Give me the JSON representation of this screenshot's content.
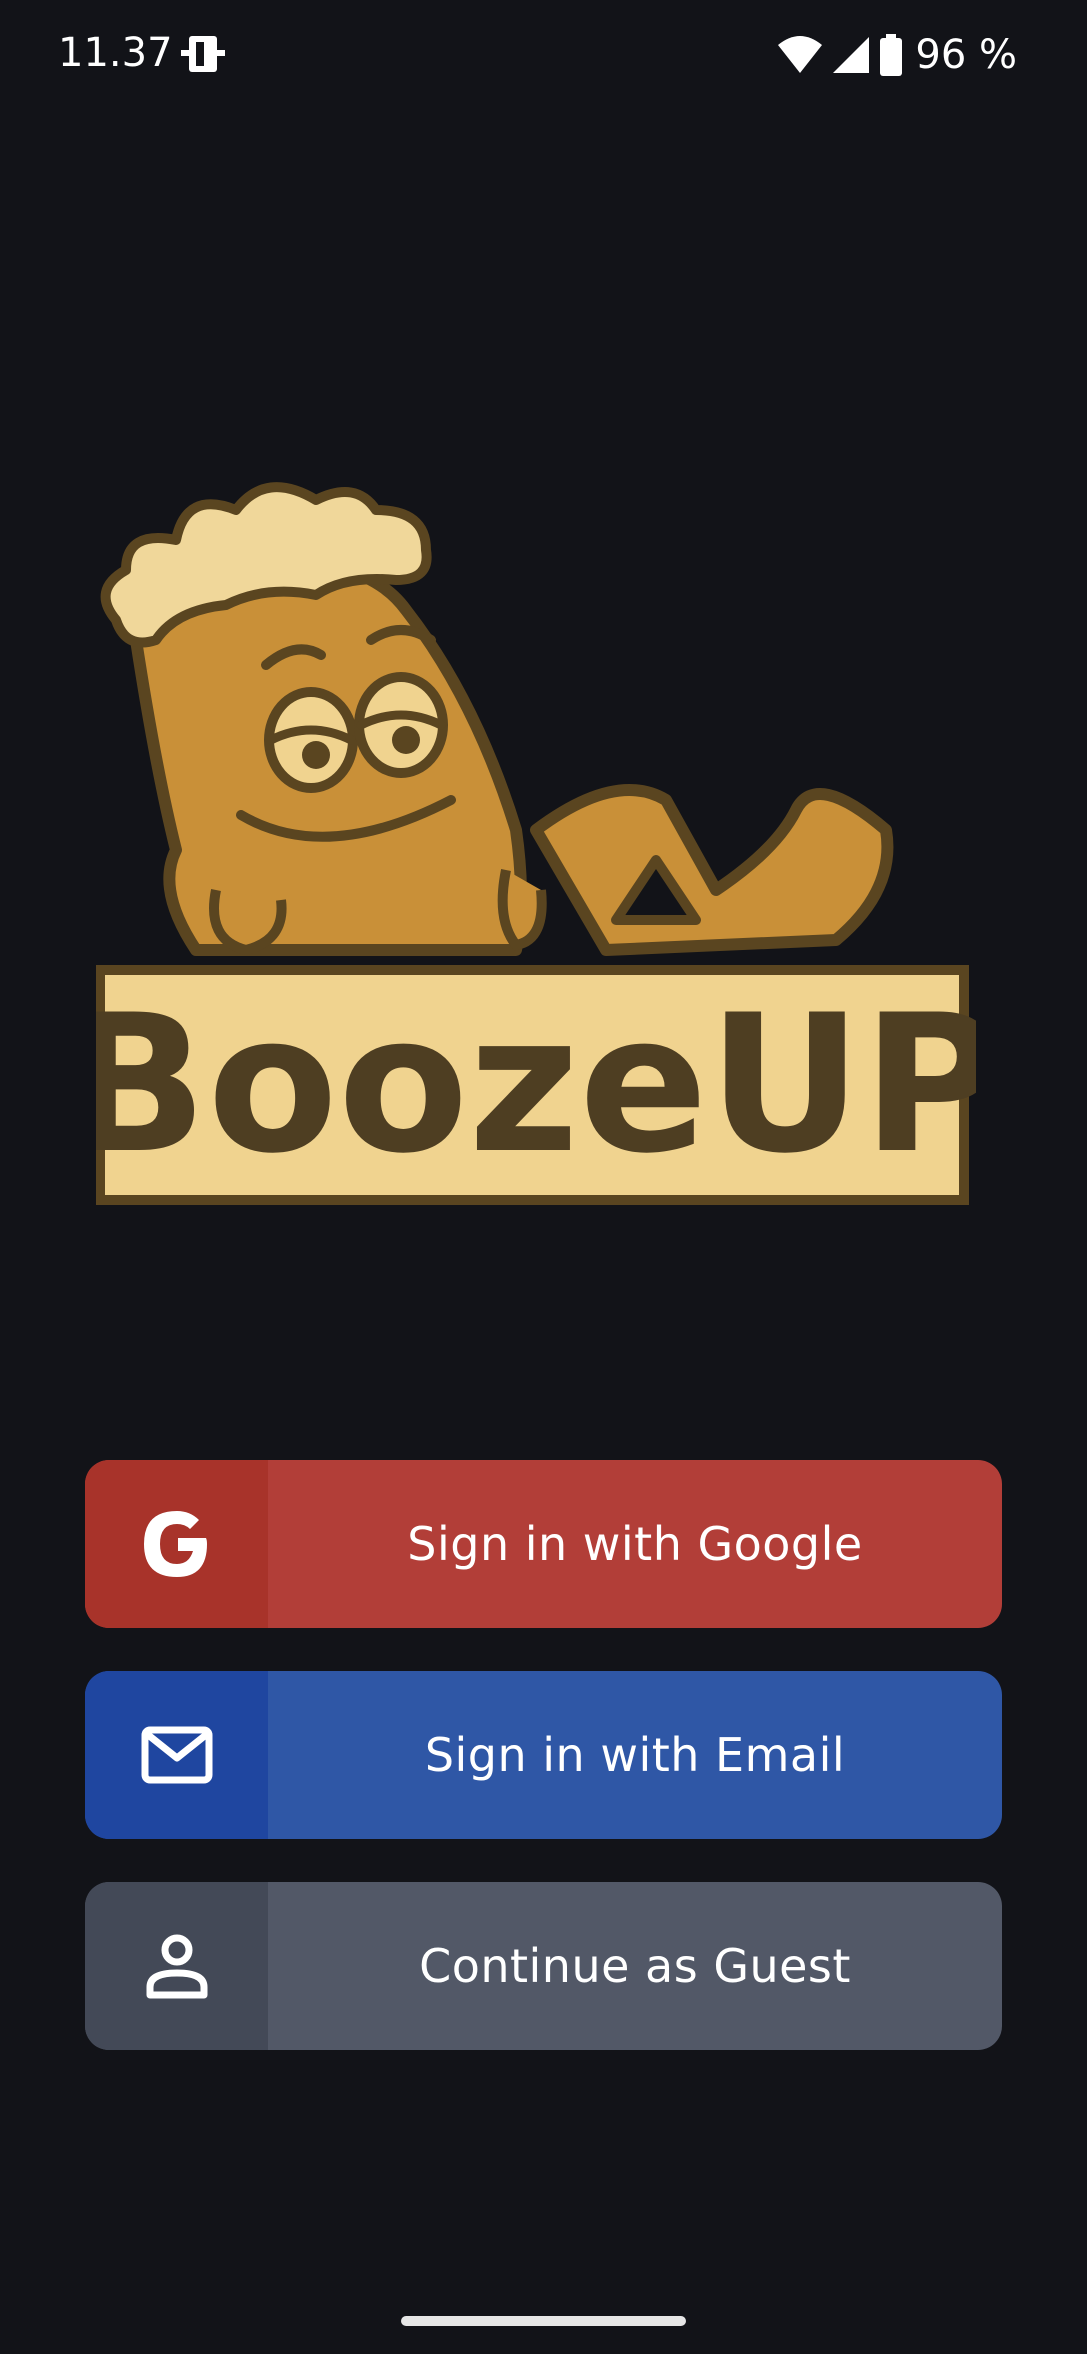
{
  "status_bar": {
    "time": "11.37",
    "battery_percent": "96 %",
    "icons": [
      "sim-card-icon",
      "wifi-icon",
      "cellular-signal-icon",
      "battery-icon"
    ]
  },
  "logo": {
    "brand_name": "BoozeUP",
    "colors": {
      "body": "#c99038",
      "outline": "#5a4520",
      "foam": "#f0d79a",
      "sign": "#f0d38f",
      "text": "#4e3e22"
    }
  },
  "buttons": {
    "google": {
      "label": "Sign in with Google",
      "icon": "google-g-icon",
      "color": "#b23e38"
    },
    "email": {
      "label": "Sign in with Email",
      "icon": "envelope-icon",
      "color": "#2f57a6"
    },
    "guest": {
      "label": "Continue as Guest",
      "icon": "person-icon",
      "color": "#525867"
    }
  }
}
